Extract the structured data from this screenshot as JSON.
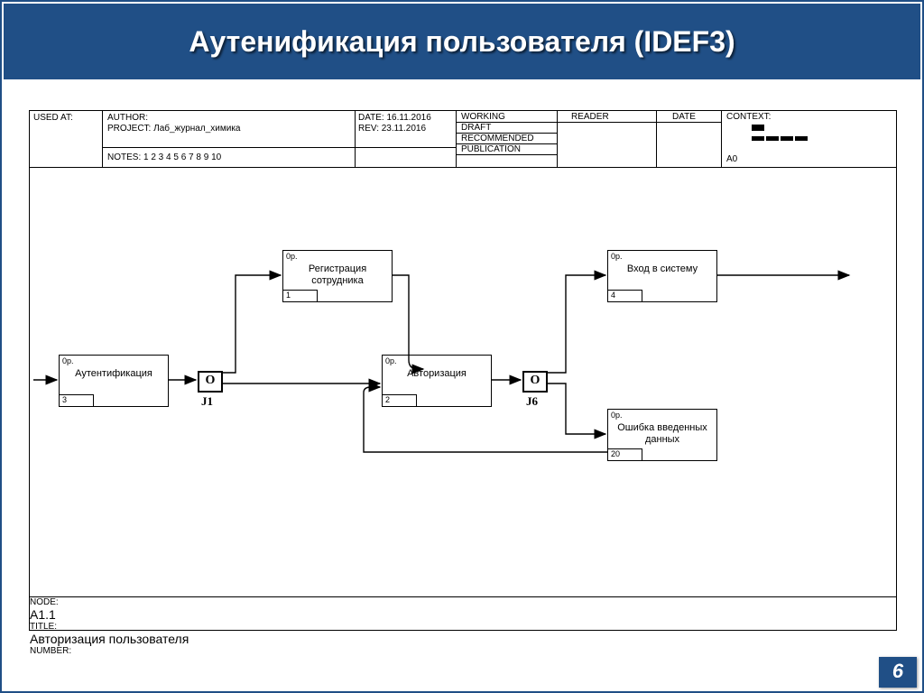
{
  "slide": {
    "title": "Аутенификация пользователя (IDEF3)",
    "page_number": "6"
  },
  "header": {
    "used_at": "USED AT:",
    "author": "AUTHOR:",
    "project_label": "PROJECT:",
    "project_value": "Лаб_журнал_химика",
    "date_label": "DATE:",
    "date_value": "16.11.2016",
    "rev_label": "REV:",
    "rev_value": "23.11.2016",
    "notes": "NOTES:  1  2  3  4  5  6  7  8  9  10",
    "status": [
      "WORKING",
      "DRAFT",
      "RECOMMENDED",
      "PUBLICATION"
    ],
    "reader": "READER",
    "date_col": "DATE",
    "context": "CONTEXT:",
    "context_id": "A0"
  },
  "footer": {
    "node_label": "NODE:",
    "node_value": "A1.1",
    "title_label": "TITLE:",
    "title_value": "Авторизация пользователя",
    "number_label": "NUMBER:"
  },
  "boxes": {
    "b3": {
      "corner": "0р.",
      "label": "Аутентификация",
      "id": "3"
    },
    "b1": {
      "corner": "0р.",
      "label": "Регистрация сотрудника",
      "id": "1"
    },
    "b2": {
      "corner": "0р.",
      "label": "Авторизация",
      "id": "2"
    },
    "b4": {
      "corner": "0р.",
      "label": "Вход в систему",
      "id": "4"
    },
    "b20": {
      "corner": "0р.",
      "label": "Ошибка введенных данных",
      "id": "20"
    }
  },
  "junctions": {
    "j1": {
      "sym": "O",
      "label": "J1"
    },
    "j6": {
      "sym": "O",
      "label": "J6"
    }
  }
}
